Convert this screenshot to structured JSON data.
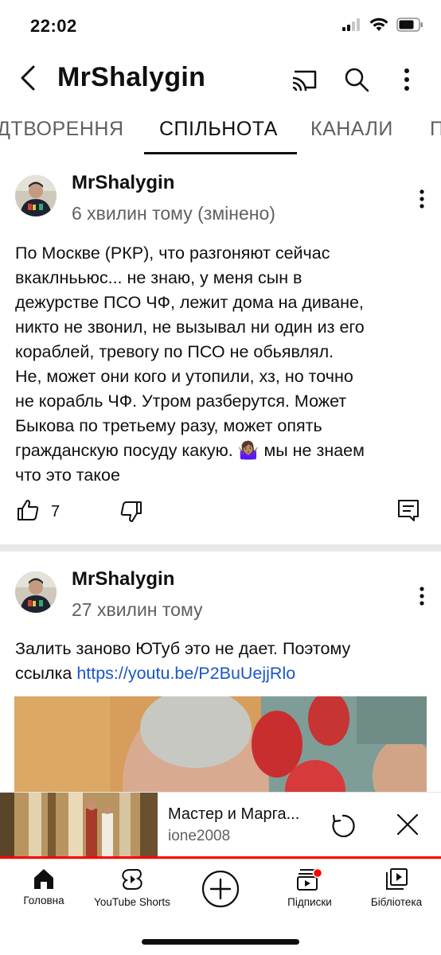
{
  "status_bar": {
    "time": "22:02"
  },
  "header": {
    "channel_name": "MrShalygin"
  },
  "tabs": [
    {
      "label": "ДТВОРЕННЯ",
      "active": false
    },
    {
      "label": "СПІЛЬНОТА",
      "active": true
    },
    {
      "label": "КАНАЛИ",
      "active": false
    },
    {
      "label": "П",
      "active": false
    }
  ],
  "posts": [
    {
      "author": "MrShalygin",
      "time": "6 хвилин тому (змінено)",
      "text_lines": [
        "По Москве (РКР), что разгоняют сейчас",
        "вкаклнььюс... не знаю, у меня сын в",
        "дежурстве ПСО ЧФ, лежит дома на диване,",
        "никто не звонил, не вызывал ни один из его",
        "кораблей, тревогу по ПСО не обьявлял.",
        "Не, может они кого и утопили, хз, но точно",
        "не корабль ЧФ. Утром разберутся. Может",
        "Быкова по третьему разу, может опять",
        "гражданскую посуду какую. 🤷🏽‍♀️ мы не знаем",
        "что это такое"
      ],
      "likes": "7"
    },
    {
      "author": "MrShalygin",
      "time": "27 хвилин тому",
      "text_line1": "Залить заново ЮТуб это не дает. Поэтому",
      "text_line2_prefix": "ссылка ",
      "link": "https://youtu.be/P2BuUejjRlo"
    }
  ],
  "miniplayer": {
    "title": "Мастер и Марга...",
    "channel": "ione2008",
    "progress": 1.0
  },
  "bottom_nav": [
    {
      "label": "Головна",
      "icon": "home-icon"
    },
    {
      "label": "YouTube Shorts",
      "icon": "shorts-icon"
    },
    {
      "label": "",
      "icon": "create-icon"
    },
    {
      "label": "Підписки",
      "icon": "subscriptions-icon"
    },
    {
      "label": "Бібліотека",
      "icon": "library-icon"
    }
  ],
  "colors": {
    "accent": "#ff0000",
    "link": "#1a56c8",
    "secondary_text": "#606060"
  }
}
